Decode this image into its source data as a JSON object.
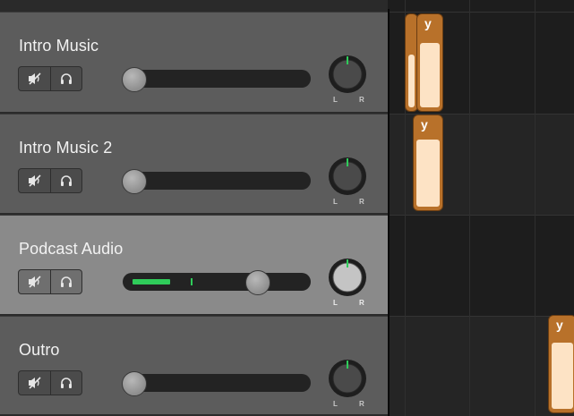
{
  "tracks": [
    {
      "name": "Intro Music",
      "selected": false,
      "volume": 0.0,
      "meter_level": 0.0,
      "pan": 0
    },
    {
      "name": "Intro Music 2",
      "selected": false,
      "volume": 0.0,
      "meter_level": 0.0,
      "pan": 0
    },
    {
      "name": "Podcast Audio",
      "selected": true,
      "volume": 0.74,
      "meter_level": 0.27,
      "pan": 0
    },
    {
      "name": "Outro",
      "selected": false,
      "volume": 0.0,
      "meter_level": 0.0,
      "pan": 0
    }
  ],
  "controls": {
    "mute_icon": "speaker-muted-icon",
    "headphones_icon": "headphones-icon"
  },
  "pan_labels": {
    "left": "L",
    "right": "R"
  },
  "regions": [
    {
      "track": 0,
      "label": "y"
    },
    {
      "track": 1,
      "label": "y"
    },
    {
      "track": 3,
      "label": "y"
    }
  ],
  "colors": {
    "region": "#b8712a",
    "waveform": "#fde3c5",
    "meter": "#2fcc5a",
    "pan_indicator": "#2fcc5a"
  }
}
